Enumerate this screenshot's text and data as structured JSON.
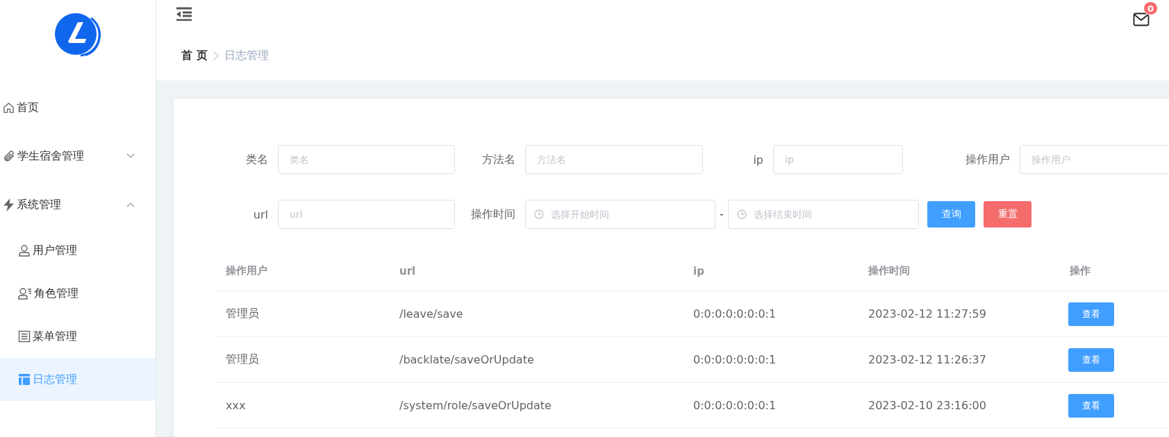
{
  "sidebar": {
    "items": [
      {
        "label": "首页",
        "selected": false
      },
      {
        "label": "学生宿舍管理",
        "expanded": false,
        "selected": false
      },
      {
        "label": "系统管理",
        "expanded": true,
        "selected": false,
        "children": [
          {
            "label": "用户管理",
            "selected": false
          },
          {
            "label": "角色管理",
            "selected": false
          },
          {
            "label": "菜单管理",
            "selected": false
          },
          {
            "label": "日志管理",
            "selected": true
          }
        ]
      }
    ]
  },
  "header": {
    "notification_count": "0"
  },
  "breadcrumb": [
    "首 页",
    "日志管理"
  ],
  "filters": {
    "rows": [
      [
        {
          "label": "类名",
          "placeholder": "类名"
        },
        {
          "label": "方法名",
          "placeholder": "方法名"
        },
        {
          "label": "ip",
          "placeholder": "ip"
        },
        {
          "label": "操作用户",
          "placeholder": "操作用户"
        }
      ],
      [
        {
          "label": "url",
          "placeholder": "url"
        },
        {
          "label": "操作时间",
          "placeholder": "选择开始时间",
          "kind": "range",
          "separator": "-",
          "placeholder_end": "选择结束时间"
        }
      ]
    ],
    "buttons": [
      {
        "label": "查询",
        "kind": "primary"
      },
      {
        "label": "重置",
        "kind": "danger"
      }
    ]
  },
  "table": {
    "columns": [
      "操作用户",
      "url",
      "ip",
      "操作时间",
      "操作"
    ],
    "rows": [
      {
        "cells": [
          "管理员",
          "/leave/save",
          "0:0:0:0:0:0:0:1",
          "2023-02-12 11:27:59"
        ],
        "action": "查看"
      },
      {
        "cells": [
          "管理员",
          "/backlate/saveOrUpdate",
          "0:0:0:0:0:0:0:1",
          "2023-02-12 11:26:37"
        ],
        "action": "查看"
      },
      {
        "cells": [
          "xxx",
          "/system/role/saveOrUpdate",
          "0:0:0:0:0:0:0:1",
          "2023-02-10 23:16:00"
        ],
        "action": "查看"
      }
    ]
  }
}
